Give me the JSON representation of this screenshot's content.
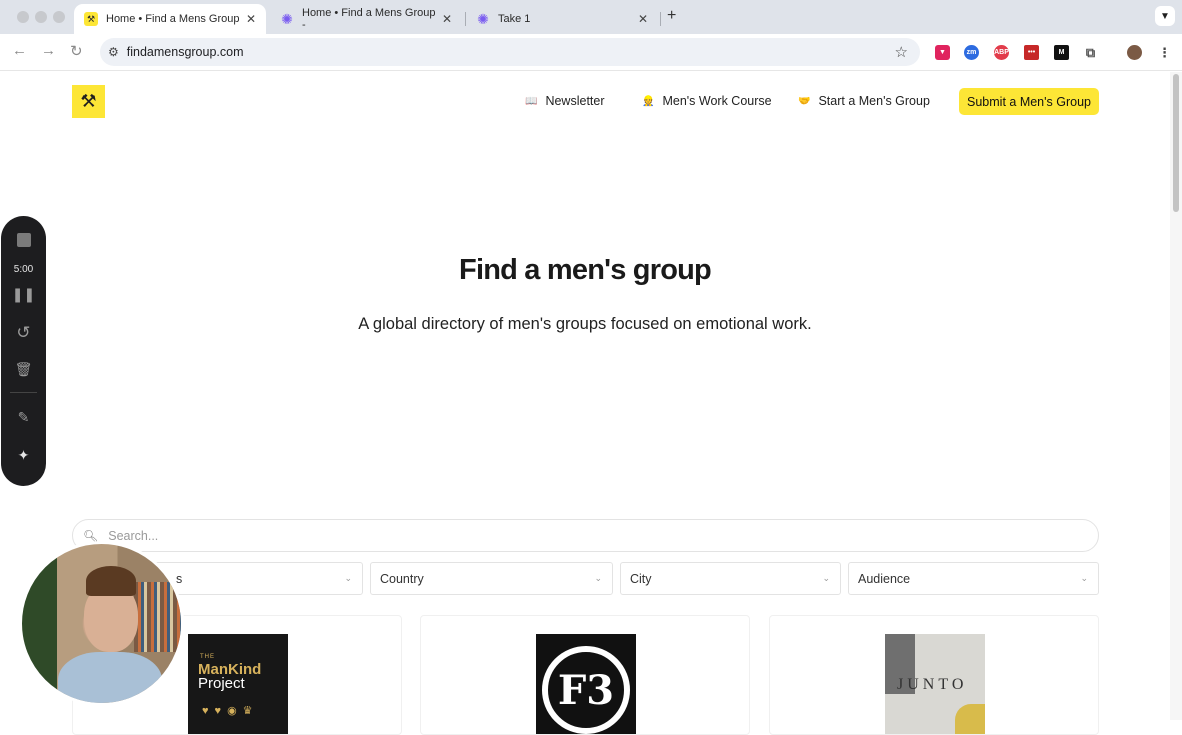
{
  "browser": {
    "tabs": [
      {
        "title": "Home • Find a Mens Group",
        "active": true
      },
      {
        "title": "Home • Find a Mens Group -",
        "active": false
      },
      {
        "title": "Take 1",
        "active": false
      }
    ],
    "url": "findamensgroup.com"
  },
  "site": {
    "nav": [
      {
        "emoji": "📖",
        "label": "Newsletter"
      },
      {
        "emoji": "👷",
        "label": "Men's Work Course"
      },
      {
        "emoji": "🤝",
        "label": "Start a Men's Group"
      }
    ],
    "cta_label": "Submit a Men's Group",
    "accent_color": "#fde636"
  },
  "hero": {
    "title": "Find a men's group",
    "subtitle": "A global directory of men's groups focused on emotional work."
  },
  "search": {
    "placeholder": "Search..."
  },
  "filters": [
    {
      "label": "s"
    },
    {
      "label": "Country"
    },
    {
      "label": "City"
    },
    {
      "label": "Audience"
    }
  ],
  "cards": [
    {
      "logo_text_1": "THE",
      "logo_text_2": "ManKind",
      "logo_text_3": "Project"
    },
    {
      "logo_text": "F3"
    },
    {
      "logo_text": "JUNTO"
    }
  ],
  "recorder": {
    "time": "5:00"
  }
}
